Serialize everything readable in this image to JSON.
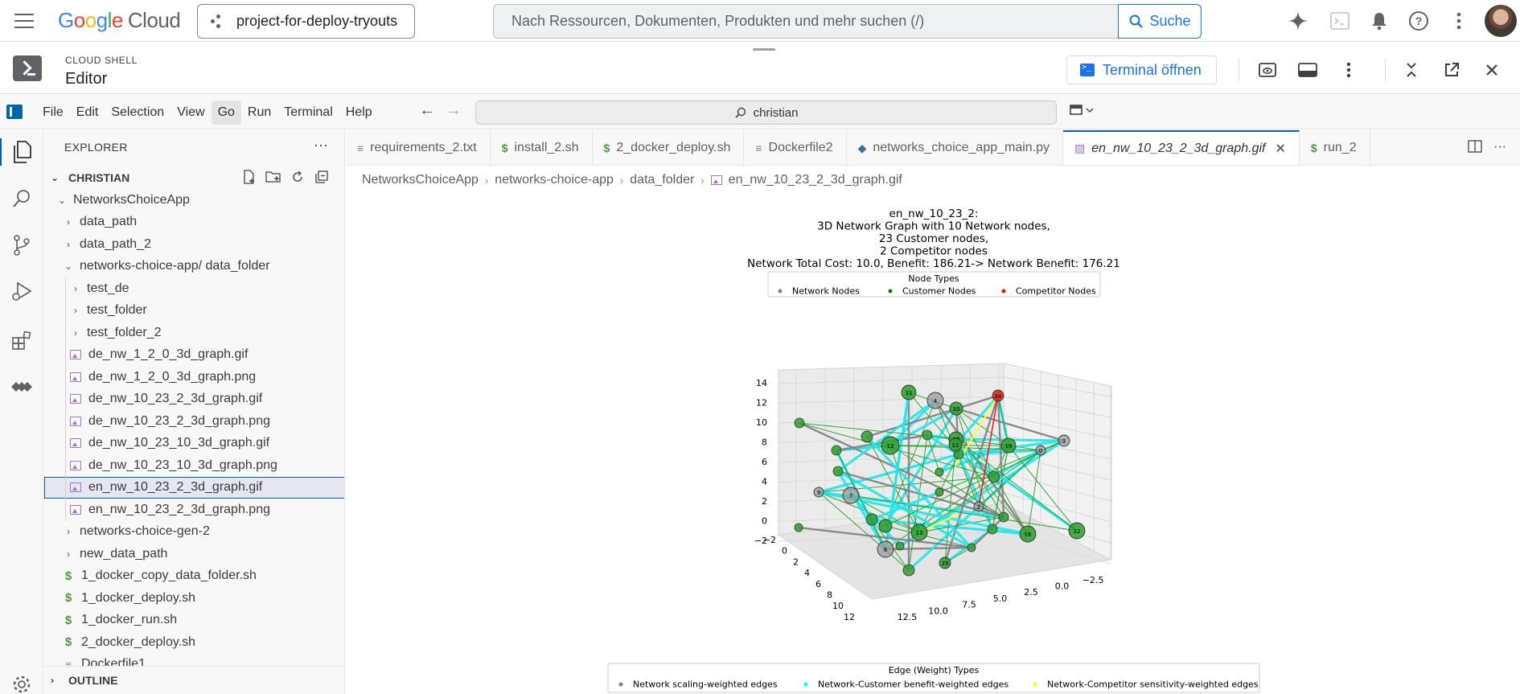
{
  "gcp": {
    "logo_google": "Google",
    "logo_cloud": "Cloud",
    "project": "project-for-deploy-tryouts",
    "search_placeholder": "Nach Ressourcen, Dokumenten, Produkten und mehr suchen (/)",
    "search_button": "Suche"
  },
  "shell": {
    "subtitle": "CLOUD SHELL",
    "title": "Editor",
    "terminal_button": "Terminal öffnen"
  },
  "menu": {
    "items": [
      "File",
      "Edit",
      "Selection",
      "View",
      "Go",
      "Run",
      "Terminal",
      "Help"
    ],
    "active": "Go",
    "command_center": "christian"
  },
  "sidebar": {
    "title": "EXPLORER",
    "section": "CHRISTIAN",
    "outline": "OUTLINE",
    "tree": [
      {
        "label": "NetworksChoiceApp",
        "type": "folder-open",
        "depth": 1
      },
      {
        "label": "data_path",
        "type": "folder",
        "depth": 2
      },
      {
        "label": "data_path_2",
        "type": "folder",
        "depth": 2
      },
      {
        "label": "networks-choice-app",
        "suffix": " / data_folder",
        "type": "folder-open",
        "depth": 2
      },
      {
        "label": "test_de",
        "type": "folder",
        "depth": 3
      },
      {
        "label": "test_folder",
        "type": "folder",
        "depth": 3
      },
      {
        "label": "test_folder_2",
        "type": "folder",
        "depth": 3
      },
      {
        "label": "de_nw_1_2_0_3d_graph.gif",
        "type": "image",
        "depth": 3
      },
      {
        "label": "de_nw_1_2_0_3d_graph.png",
        "type": "image",
        "depth": 3
      },
      {
        "label": "de_nw_10_23_2_3d_graph.gif",
        "type": "image",
        "depth": 3
      },
      {
        "label": "de_nw_10_23_2_3d_graph.png",
        "type": "image",
        "depth": 3
      },
      {
        "label": "de_nw_10_23_10_3d_graph.gif",
        "type": "image",
        "depth": 3
      },
      {
        "label": "de_nw_10_23_10_3d_graph.png",
        "type": "image",
        "depth": 3
      },
      {
        "label": "en_nw_10_23_2_3d_graph.gif",
        "type": "image",
        "depth": 3,
        "selected": true
      },
      {
        "label": "en_nw_10_23_2_3d_graph.png",
        "type": "image",
        "depth": 3
      },
      {
        "label": "networks-choice-gen-2",
        "type": "folder",
        "depth": 2
      },
      {
        "label": "new_data_path",
        "type": "folder",
        "depth": 2
      },
      {
        "label": "1_docker_copy_data_folder.sh",
        "type": "shell",
        "depth": 2
      },
      {
        "label": "1_docker_deploy.sh",
        "type": "shell",
        "depth": 2
      },
      {
        "label": "1_docker_run.sh",
        "type": "shell",
        "depth": 2
      },
      {
        "label": "2_docker_deploy.sh",
        "type": "shell",
        "depth": 2
      },
      {
        "label": "Dockerfile1",
        "type": "text",
        "depth": 2
      }
    ]
  },
  "tabs": [
    {
      "label": "requirements_2.txt",
      "icon": "text"
    },
    {
      "label": "install_2.sh",
      "icon": "shell"
    },
    {
      "label": "2_docker_deploy.sh",
      "icon": "shell"
    },
    {
      "label": "Dockerfile2",
      "icon": "text"
    },
    {
      "label": "networks_choice_app_main.py",
      "icon": "python"
    },
    {
      "label": "en_nw_10_23_2_3d_graph.gif",
      "icon": "image",
      "active": true
    },
    {
      "label": "run_2",
      "icon": "shell"
    }
  ],
  "breadcrumb": [
    "NetworksChoiceApp",
    "networks-choice-app",
    "data_folder",
    "en_nw_10_23_2_3d_graph.gif"
  ],
  "graph": {
    "title_lines": [
      "en_nw_10_23_2:",
      "3D Network Graph with 10 Network nodes,",
      "23 Customer nodes,",
      "2 Competitor nodes",
      "Network Total Cost: 10.0, Benefit: 186.21-> Network Benefit: 176.21"
    ],
    "node_legend_title": "Node Types",
    "node_legend": [
      {
        "label": "Network Nodes",
        "color": "#808080"
      },
      {
        "label": "Customer Nodes",
        "color": "#008000"
      },
      {
        "label": "Competitor Nodes",
        "color": "#ff0000"
      }
    ],
    "edge_legend_title": "Edge (Weight) Types",
    "edge_legend": [
      {
        "label": "Network scaling-weighted edges",
        "color": "#808080"
      },
      {
        "label": "Network-Customer benefit-weighted edges",
        "color": "#00ffff"
      },
      {
        "label": "Network-Competitor sensitivity-weighted edges",
        "color": "#ffff00"
      }
    ],
    "z_ticks": [
      "14",
      "12",
      "10",
      "8",
      "6",
      "4",
      "2",
      "0",
      "−2"
    ],
    "y_ticks": [
      "−2",
      "0",
      "2",
      "4",
      "6",
      "8",
      "10",
      "12"
    ],
    "x_ticks": [
      "12.5",
      "10.0",
      "7.5",
      "5.0",
      "2.5",
      "0.0",
      "−2.5"
    ],
    "nodes": [
      {
        "label": "31",
        "kind": "customer"
      },
      {
        "label": "4",
        "kind": "network"
      },
      {
        "label": "33",
        "kind": "customer"
      },
      {
        "label": "34",
        "kind": "competitor"
      },
      {
        "label": "27",
        "kind": "customer"
      },
      {
        "label": "3",
        "kind": "network"
      },
      {
        "label": "7",
        "kind": "network"
      },
      {
        "label": "11",
        "kind": "customer"
      },
      {
        "label": "0",
        "kind": "network"
      },
      {
        "label": "9",
        "kind": "network"
      },
      {
        "label": "2",
        "kind": "network"
      },
      {
        "label": "6",
        "kind": "network"
      },
      {
        "label": "16",
        "kind": "customer"
      },
      {
        "label": "22",
        "kind": "customer"
      },
      {
        "label": "13",
        "kind": "customer"
      },
      {
        "label": "19",
        "kind": "customer"
      },
      {
        "label": "29",
        "kind": "customer"
      },
      {
        "label": "12",
        "kind": "customer"
      }
    ]
  }
}
